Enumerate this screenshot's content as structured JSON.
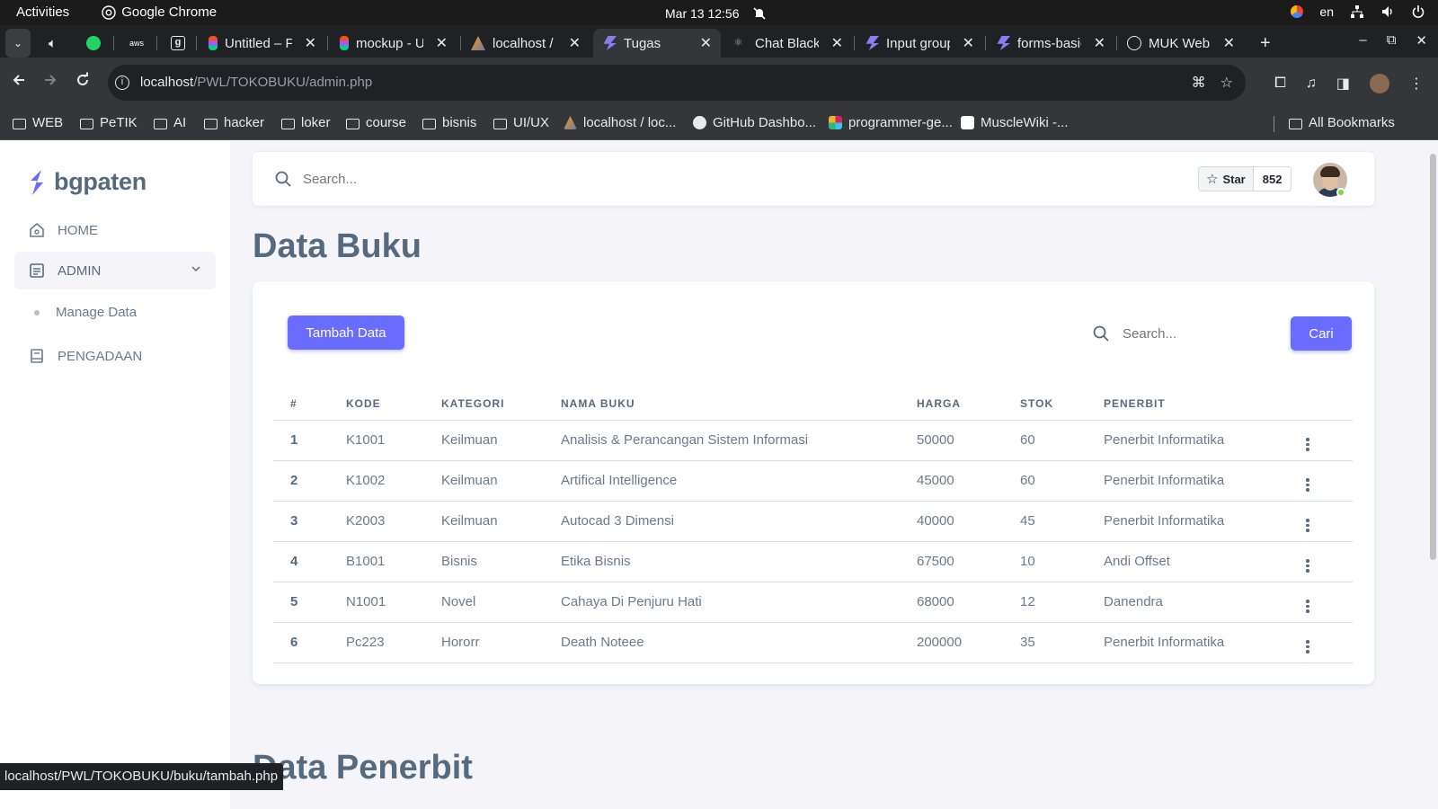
{
  "os_bar": {
    "activities": "Activities",
    "app_name": "Google Chrome",
    "clock": "Mar 13  12:56",
    "lang": "en"
  },
  "tabs": [
    {
      "title": "",
      "icon": "whatsapp-icon"
    },
    {
      "title": "",
      "icon": "aws-icon"
    },
    {
      "title": "",
      "icon": "g-icon"
    },
    {
      "title": "Untitled – F",
      "icon": "figma-icon"
    },
    {
      "title": "mockup - U",
      "icon": "figma-icon"
    },
    {
      "title": "localhost /",
      "icon": "phpmyadmin-icon"
    },
    {
      "title": "Tugas",
      "icon": "bootstrap-icon",
      "active": true
    },
    {
      "title": "Chat Blackb",
      "icon": "blackbox-icon"
    },
    {
      "title": "Input group",
      "icon": "bootstrap-icon"
    },
    {
      "title": "forms-basic",
      "icon": "bootstrap-icon"
    },
    {
      "title": "MUK Web",
      "icon": "globe-icon"
    }
  ],
  "toolbar": {
    "url_host": "localhost",
    "url_path": "/PWL/TOKOBUKU/admin.php"
  },
  "bookmarks": [
    {
      "label": "WEB",
      "type": "folder"
    },
    {
      "label": "PeTIK",
      "type": "folder"
    },
    {
      "label": "AI",
      "type": "folder"
    },
    {
      "label": "hacker",
      "type": "folder"
    },
    {
      "label": "loker",
      "type": "folder"
    },
    {
      "label": "course",
      "type": "folder"
    },
    {
      "label": "bisnis",
      "type": "folder"
    },
    {
      "label": "UI/UX",
      "type": "folder"
    },
    {
      "label": "localhost / loc...",
      "type": "link"
    },
    {
      "label": "GitHub Dashbo...",
      "type": "link"
    },
    {
      "label": "programmer-ge...",
      "type": "link"
    },
    {
      "label": "MuscleWiki -...",
      "type": "link"
    },
    {
      "label": "All Bookmarks",
      "type": "folder"
    }
  ],
  "sidebar": {
    "brand": "bgpaten",
    "menu": [
      {
        "label": "HOME"
      },
      {
        "label": "ADMIN"
      },
      {
        "label": "PENGADAAN"
      }
    ],
    "submenu": {
      "label": "Manage Data"
    }
  },
  "navbar": {
    "search_placeholder": "Search...",
    "star_label": "Star",
    "star_count": "852"
  },
  "main": {
    "title": "Data Buku",
    "add_button": "Tambah Data",
    "search_placeholder": "Search...",
    "search_button": "Cari",
    "table": {
      "headers": [
        "#",
        "KODE",
        "KATEGORI",
        "NAMA BUKU",
        "HARGA",
        "STOK",
        "PENERBIT"
      ],
      "rows": [
        [
          "1",
          "K1001",
          "Keilmuan",
          "Analisis & Perancangan Sistem Informasi",
          "50000",
          "60",
          "Penerbit Informatika"
        ],
        [
          "2",
          "K1002",
          "Keilmuan",
          "Artifical Intelligence",
          "45000",
          "60",
          "Penerbit Informatika"
        ],
        [
          "3",
          "K2003",
          "Keilmuan",
          "Autocad 3 Dimensi",
          "40000",
          "45",
          "Penerbit Informatika"
        ],
        [
          "4",
          "B1001",
          "Bisnis",
          "Etika Bisnis",
          "67500",
          "10",
          "Andi Offset"
        ],
        [
          "5",
          "N1001",
          "Novel",
          "Cahaya Di Penjuru Hati",
          "68000",
          "12",
          "Danendra"
        ],
        [
          "6",
          "Pc223",
          "Hororr",
          "Death Noteee",
          "200000",
          "35",
          "Penerbit Informatika"
        ]
      ]
    },
    "section2_title": "Data Penerbit"
  },
  "statusbar": {
    "url": "localhost/PWL/TOKOBUKU/buku/tambah.php"
  },
  "colors": {
    "primary": "#696cff",
    "text": "#566a7f",
    "background": "#f5f5f9",
    "chrome_dark": "#202124"
  }
}
